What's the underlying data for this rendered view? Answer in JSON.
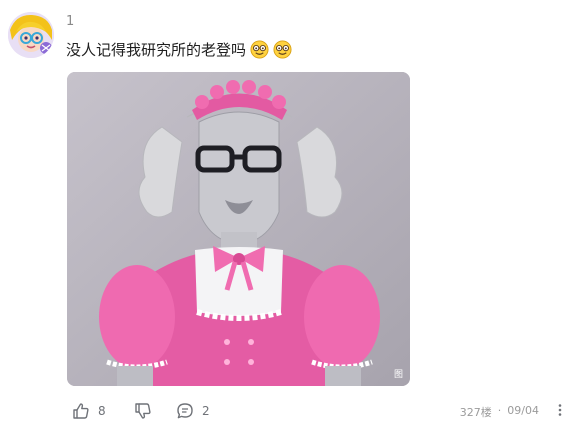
{
  "post": {
    "username": "1",
    "comment_text": "没人记得我研究所的老登吗",
    "comment_emojis": [
      "smiling-face-with-glasses-emoji",
      "smiling-face-with-glasses-emoji"
    ],
    "image_watermark": "图"
  },
  "actions": {
    "like_count": "8",
    "dislike_label": "",
    "reply_count": "2"
  },
  "meta": {
    "floor": "327楼",
    "separator": "·",
    "date": "09/04"
  },
  "colors": {
    "text_primary": "#1f1f1f",
    "text_secondary": "#8a8a8a",
    "icon_gray": "#6f7278",
    "image_bg": "#b9b5bc",
    "dress_pink": "#e45ca4"
  }
}
